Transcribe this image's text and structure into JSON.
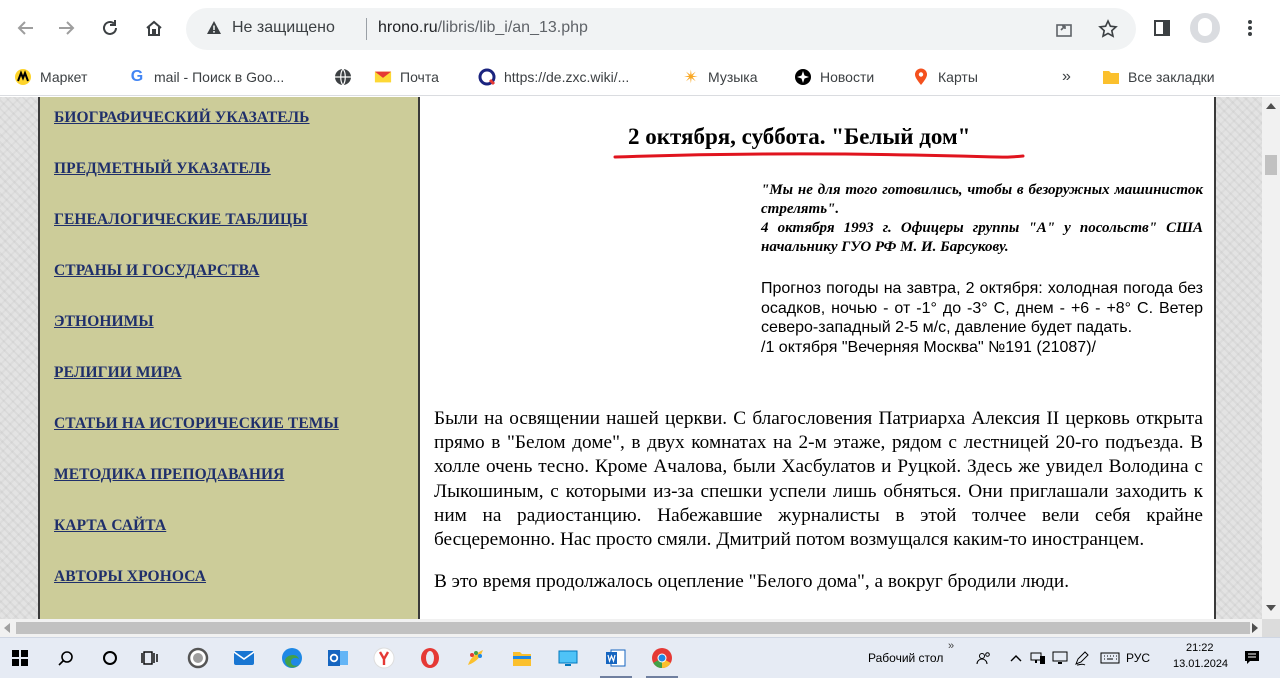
{
  "browser": {
    "insecure_label": "Не защищено",
    "url_host": "hrono.ru",
    "url_path": "/libris/lib_i/an_13.php",
    "bookmarks": [
      {
        "label": "Маркет",
        "icon": "market-icon"
      },
      {
        "label": "mail - Поиск в Goo...",
        "icon": "google-icon"
      },
      {
        "label": "",
        "icon": "globe-icon"
      },
      {
        "label": "Почта",
        "icon": "mail-icon"
      },
      {
        "label": "https://de.zxc.wiki/...",
        "icon": "wiki-icon"
      },
      {
        "label": "Музыка",
        "icon": "music-icon"
      },
      {
        "label": "Новости",
        "icon": "news-icon"
      },
      {
        "label": "Карты",
        "icon": "maps-icon"
      }
    ],
    "bookmarks_more": "»",
    "all_bookmarks_label": "Все закладки"
  },
  "sidebar": {
    "items": [
      "БИОГРАФИЧЕСКИЙ УКАЗАТЕЛЬ",
      "ПРЕДМЕТНЫЙ УКАЗАТЕЛЬ",
      "ГЕНЕАЛОГИЧЕСКИЕ ТАБЛИЦЫ",
      "СТРАНЫ И ГОСУДАРСТВА",
      "ЭТНОНИМЫ",
      "РЕЛИГИИ МИРА",
      "СТАТЬИ НА ИСТОРИЧЕСКИЕ ТЕМЫ",
      "МЕТОДИКА ПРЕПОДАВАНИЯ",
      "КАРТА САЙТА",
      "АВТОРЫ ХРОНОСА"
    ]
  },
  "article": {
    "title": "2 октября, суббота. \"Белый дом\"",
    "epigraph": "\"Мы не для того готовились, чтобы в безоружных машинисток стрелять\".",
    "epigraph_source": "4 октября 1993 г. Офицеры группы \"А\" у посольств\" США начальнику ГУО РФ М. И. Барсукову.",
    "weather": "Прогноз погоды на завтра, 2 октября: холодная погода без осадков, ночью - от -1° до -3° С, днем - +6 - +8° С. Ветер северо-западный 2-5 м/с, давление будет падать.",
    "weather_source": "/1 октября \"Вечерняя Москва\" №191 (21087)/",
    "paragraph1": "Были на освящении нашей церкви. С благословения Патриарха Алексия II церковь открыта прямо в \"Белом доме\", в двух комнатах на 2-м этаже, рядом с лестницей 20-го подъезда. В холле очень тесно. Кроме Ачалова, были Хасбулатов и Руцкой. Здесь же увидел Володина с Лыкошиным, с которыми из-за спешки успели лишь обняться. Они приглашали заходить к ним на радиостанцию. Набежавшие журналисты в этой толчее вели себя крайне бесцеремонно. Нас просто смяли. Дмитрий потом возмущался каким-то иностранцем.",
    "paragraph2": "В это время продолжалось оцепление \"Белого дома\", а вокруг бродили люди."
  },
  "taskbar": {
    "desktop_label": "Рабочий стол",
    "lang": "РУС",
    "time": "21:22",
    "date": "13.01.2024"
  },
  "colors": {
    "sidebar_bg": "#cccc99",
    "link": "#1f2f6b",
    "underline_red": "#e0141e"
  }
}
